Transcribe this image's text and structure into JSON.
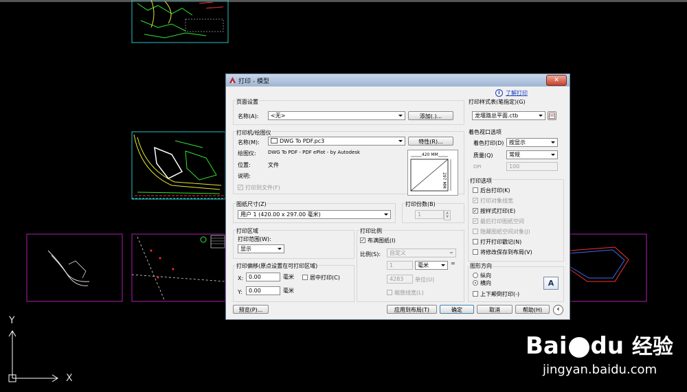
{
  "dialog": {
    "title": "打印 - 模型",
    "close_glyph": "✕",
    "help_link": "了解打印",
    "info_glyph": "i"
  },
  "page_setup": {
    "group": "页面设置",
    "name_label": "名称(A):",
    "name_value": "<无>",
    "add_button": "添加(.)..."
  },
  "printer": {
    "group": "打印机/绘图仪",
    "name_label": "名称(M):",
    "name_value": "DWG To PDF.pc3",
    "properties_button": "特性(R)...",
    "plotter_label": "绘图仪:",
    "plotter_value": "DWG To PDF - PDF ePlot - by Autodesk",
    "location_label": "位置:",
    "location_value": "文件",
    "description_label": "说明:",
    "print_to_file": "打印到文件(F)",
    "preview_width": "420 MM",
    "preview_height": "297 MM"
  },
  "paper_size": {
    "group": "图纸尺寸(Z)",
    "value": "用户 1 (420.00 x 297.00 毫米)"
  },
  "copies": {
    "group": "打印份数(B)",
    "value": "1"
  },
  "plot_area": {
    "group": "打印区域",
    "range_label": "打印范围(W):",
    "range_value": "显示"
  },
  "plot_offset": {
    "group": "打印偏移(原点设置在可打印区域)",
    "x_label": "X:",
    "x_value": "0.00",
    "y_label": "Y:",
    "y_value": "0.00",
    "unit": "毫米",
    "center": "居中打印(C)"
  },
  "plot_scale": {
    "group": "打印比例",
    "fit": "布满图纸(I)",
    "scale_label": "比例(S):",
    "scale_value": "自定义",
    "num1": "1",
    "unit_value": "毫米",
    "equals": "=",
    "num2": "4283",
    "unit_label": "单位(U)",
    "scale_lineweights": "缩放线宽(L)"
  },
  "style_table": {
    "group": "打印样式表(笔指定)(G)",
    "value": "龙堰路总平面.ctb"
  },
  "shaded_viewport": {
    "group": "着色视口选项",
    "shade_label": "着色打印(D)",
    "shade_value": "按显示",
    "quality_label": "质量(Q)",
    "quality_value": "常规",
    "dpi_label": "DPI",
    "dpi_value": "100"
  },
  "plot_options": {
    "group": "打印选项",
    "items": [
      {
        "label": "后台打印(K)",
        "checked": false,
        "disabled": false
      },
      {
        "label": "打印对象线宽",
        "checked": true,
        "disabled": true
      },
      {
        "label": "按样式打印(E)",
        "checked": true,
        "disabled": false
      },
      {
        "label": "最后打印图纸空间",
        "checked": true,
        "disabled": true
      },
      {
        "label": "隐藏图纸空间对象(J)",
        "checked": false,
        "disabled": true
      },
      {
        "label": "打开打印戳记(N)",
        "checked": false,
        "disabled": false
      },
      {
        "label": "将修改保存到布局(V)",
        "checked": false,
        "disabled": false
      }
    ]
  },
  "orientation": {
    "group": "图形方向",
    "portrait": "纵向",
    "landscape": "横向",
    "upside_down": "上下颠倒打印(-)",
    "icon_letter": "A"
  },
  "buttons": {
    "preview": "预览(P)...",
    "apply_layout": "应用到布局(T)",
    "ok": "确定",
    "cancel": "取消",
    "help": "帮助(H)",
    "collapse": "‹"
  },
  "ucs": {
    "y": "Y",
    "x": "X"
  },
  "watermark": {
    "brand": "Bai",
    "brand2": "du",
    "cn": "经验",
    "url": "jingyan.baidu.com"
  }
}
